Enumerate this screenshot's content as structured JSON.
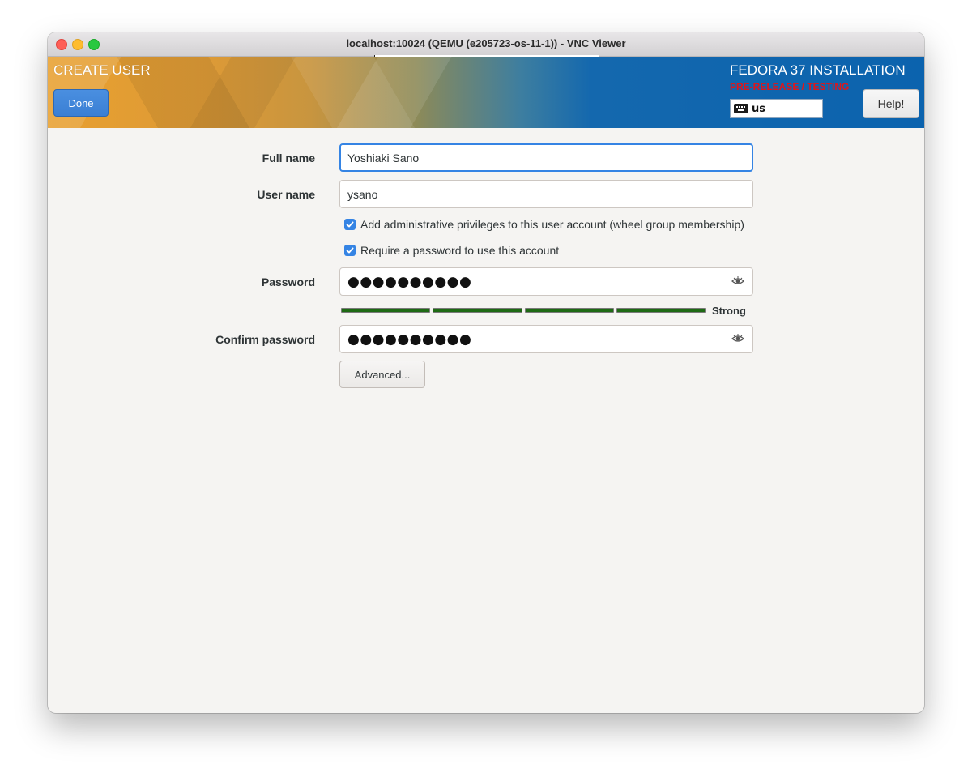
{
  "window": {
    "title": "localhost:10024 (QEMU (e205723-os-11-1)) - VNC Viewer"
  },
  "header": {
    "spoke_title": "CREATE USER",
    "done_label": "Done",
    "product_title": "FEDORA 37 INSTALLATION",
    "prerelease_label": "PRE-RELEASE / TESTING",
    "keyboard_layout": "us",
    "help_label": "Help!",
    "colors": {
      "accent": "#3584e4",
      "banner_left": "#e8a030",
      "banner_right": "#0b63ae",
      "prerelease": "#e0151a"
    }
  },
  "form": {
    "full_name": {
      "label": "Full name",
      "value": "Yoshiaki Sano"
    },
    "user_name": {
      "label": "User name",
      "value": "ysano"
    },
    "admin_checkbox": {
      "label": "Add administrative privileges to this user account (wheel group membership)",
      "checked": true
    },
    "password_checkbox": {
      "label": "Require a password to use this account",
      "checked": true
    },
    "password": {
      "label": "Password",
      "masked": "●●●●●●●●●●"
    },
    "strength": {
      "label": "Strong",
      "level": 1.0,
      "color": "#1e6a14"
    },
    "confirm_password": {
      "label": "Confirm password",
      "masked": "●●●●●●●●●●"
    },
    "advanced_label": "Advanced..."
  },
  "icons": [
    "keyboard-icon",
    "eye-icon",
    "checkmark-icon"
  ]
}
